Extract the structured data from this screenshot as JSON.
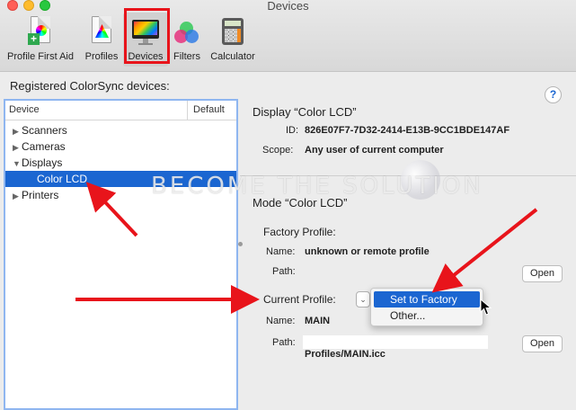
{
  "window": {
    "title": "Devices"
  },
  "toolbar": {
    "items": [
      {
        "label": "Profile First Aid",
        "icon": "profile-first-aid-icon"
      },
      {
        "label": "Profiles",
        "icon": "profiles-icon"
      },
      {
        "label": "Devices",
        "icon": "devices-icon",
        "selected": true
      },
      {
        "label": "Filters",
        "icon": "filters-icon"
      },
      {
        "label": "Calculator",
        "icon": "calculator-icon"
      }
    ]
  },
  "registered_label": "Registered ColorSync devices:",
  "device_list": {
    "columns": [
      "Device",
      "Default"
    ],
    "rows": [
      {
        "label": "Scanners",
        "expanded": false
      },
      {
        "label": "Cameras",
        "expanded": false
      },
      {
        "label": "Displays",
        "expanded": true
      },
      {
        "label": "Color LCD",
        "selected": true
      },
      {
        "label": "Printers",
        "expanded": false
      }
    ]
  },
  "display_info": {
    "title": "Display “Color LCD”",
    "id_label": "ID:",
    "id_value": "826E07F7-7D32-2414-E13B-9CC1BDE147AF",
    "scope_label": "Scope:",
    "scope_value": "Any user of current computer"
  },
  "mode": {
    "title": "Mode “Color LCD”",
    "factory_profile_label": "Factory Profile:",
    "factory_name_label": "Name:",
    "factory_name_value": "unknown or remote profile",
    "factory_path_label": "Path:",
    "open_label": "Open",
    "current_profile_label": "Current Profile:",
    "current_name_label": "Name:",
    "current_name_value": "MAIN",
    "current_path_label": "Path:",
    "current_path_value": "Profiles/MAIN.icc"
  },
  "menu": {
    "items": [
      "Set to Factory",
      "Other..."
    ],
    "highlighted": "Set to Factory"
  },
  "help_label": "?",
  "watermark": "BECOME THE SOLUTION",
  "colors": {
    "accent": "#1b66d1",
    "annotation_red": "#e8141b",
    "list_focus": "#8fb6f0"
  }
}
